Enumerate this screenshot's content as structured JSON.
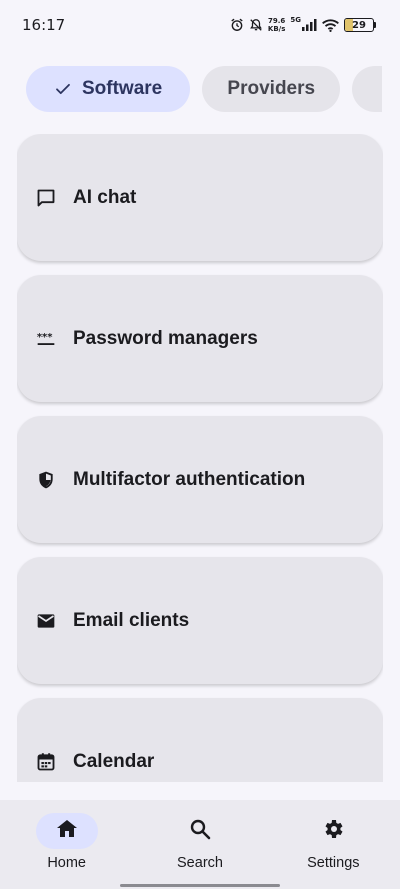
{
  "status_bar": {
    "time": "16:17",
    "net_speed_value": "79.6",
    "net_speed_unit": "KB/s",
    "network_type": "5G",
    "battery_level": "29",
    "battery_fraction": 0.29
  },
  "chips": [
    {
      "label": "Software",
      "selected": true,
      "icon": "check-icon"
    },
    {
      "label": "Providers",
      "selected": false
    },
    {
      "label": "",
      "selected": false
    }
  ],
  "categories": [
    {
      "label": "AI chat",
      "icon": "chat-bubble-icon"
    },
    {
      "label": "Password managers",
      "icon": "password-dots-icon"
    },
    {
      "label": "Multifactor authentication",
      "icon": "shield-icon"
    },
    {
      "label": "Email clients",
      "icon": "envelope-icon"
    },
    {
      "label": "Calendar",
      "icon": "calendar-icon"
    }
  ],
  "bottom_nav": [
    {
      "label": "Home",
      "icon": "home-icon",
      "active": true
    },
    {
      "label": "Search",
      "icon": "search-icon",
      "active": false
    },
    {
      "label": "Settings",
      "icon": "gear-icon",
      "active": false
    }
  ],
  "colors": {
    "background": "#f6f5fb",
    "card": "#e6e5eb",
    "selected_chip": "#dde1ff",
    "chip": "#e5e4ea",
    "nav_bar": "#ebeaf0"
  }
}
